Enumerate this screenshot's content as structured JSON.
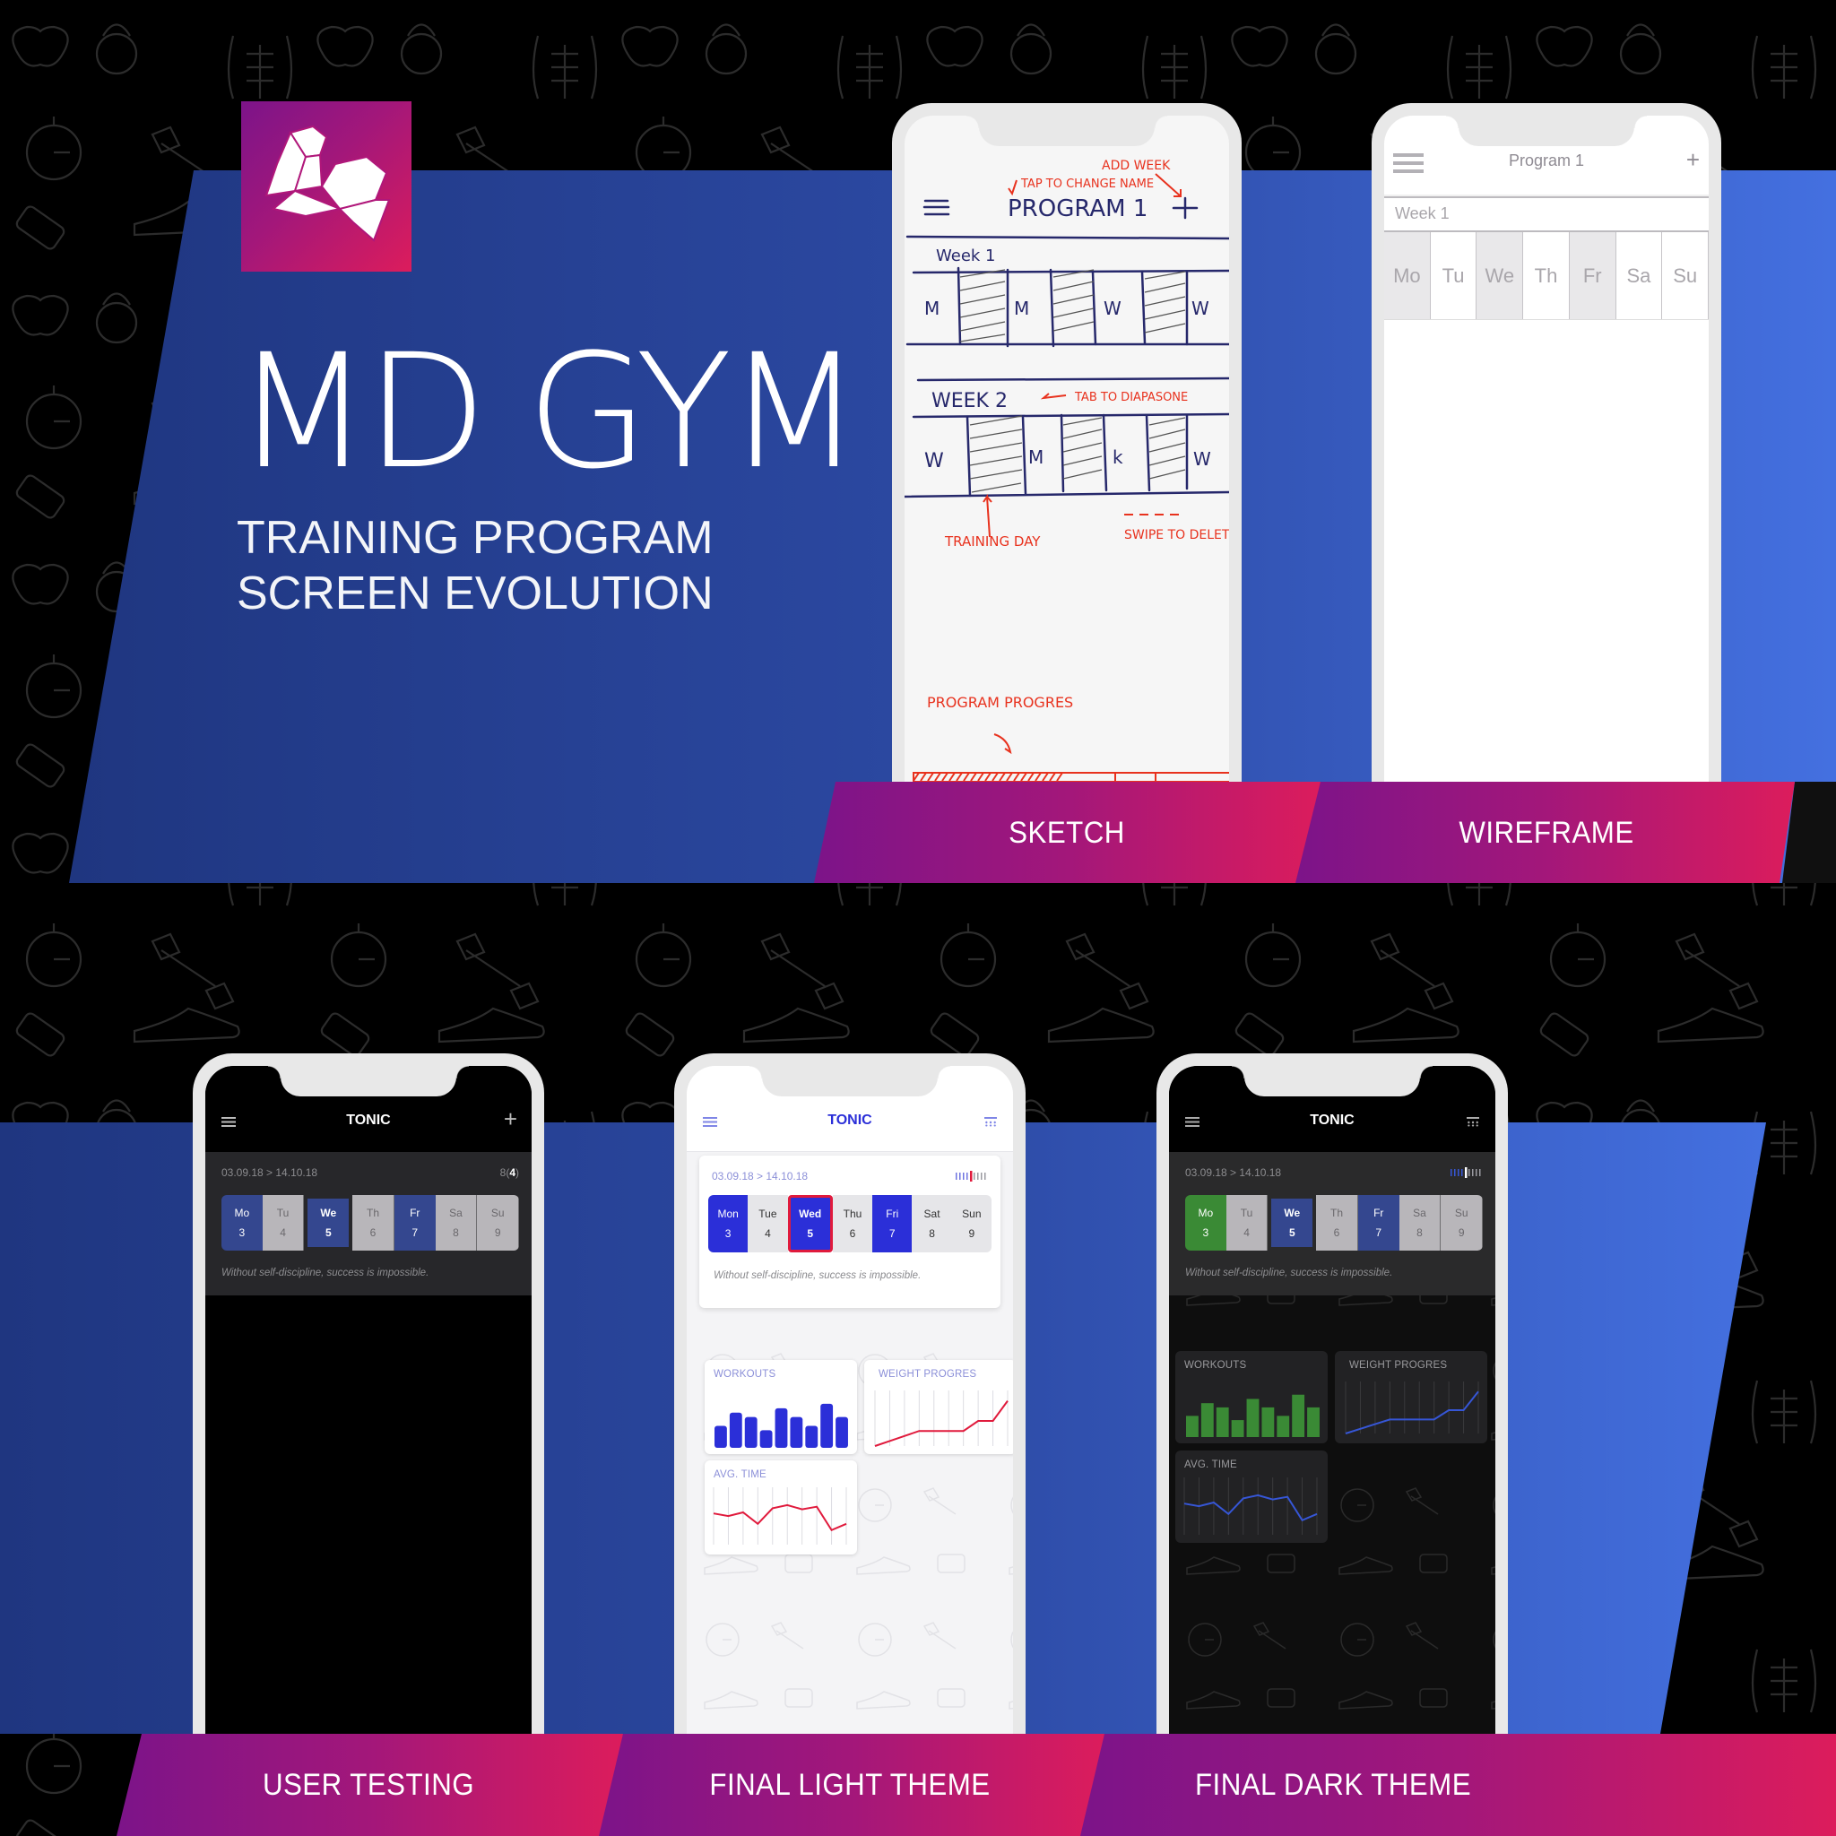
{
  "brand": {
    "title": "MD GYM",
    "subtitle_line1": "TRAINING PROGRAM",
    "subtitle_line2": "SCREEN EVOLUTION",
    "logo_icon": "flexed-bicep-icon",
    "colors": {
      "background": "#000000",
      "band_blue_dark": "#1f3680",
      "band_blue_light": "#4470e0",
      "label_purple": "#7c1489",
      "label_pink": "#dc1c5c"
    }
  },
  "stages": [
    {
      "id": "sketch",
      "label": "SKETCH"
    },
    {
      "id": "wireframe",
      "label": "WIREFRAME"
    },
    {
      "id": "user_testing",
      "label": "USER TESTING"
    },
    {
      "id": "final_light",
      "label": "FINAL LIGHT THEME"
    },
    {
      "id": "final_dark",
      "label": "FINAL DARK THEME"
    }
  ],
  "sketch": {
    "title": "PROGRAM 1",
    "week1": "Week 1",
    "week2": "WEEK 2",
    "day_letters": [
      "M",
      "M",
      "M",
      "M",
      "W",
      "W",
      "W"
    ],
    "annotations": {
      "add_week": "ADD WEEK",
      "tap_change_name": "TAP TO CHANGE NAME",
      "tab_diapasone": "TAB TO DIAPASONE",
      "training_day": "TRAINING DAY",
      "swipe_delete": "SWIPE TO DELETE",
      "program_progress": "PROGRAM PROGRES"
    },
    "annotation_color": "#e8321e",
    "ink_color": "#26286b"
  },
  "wireframe": {
    "title": "Program 1",
    "add_icon": "+",
    "week_label": "Week 1",
    "days": [
      {
        "label": "Mo",
        "filled": true
      },
      {
        "label": "Tu",
        "filled": false
      },
      {
        "label": "We",
        "filled": true
      },
      {
        "label": "Th",
        "filled": false
      },
      {
        "label": "Fr",
        "filled": true
      },
      {
        "label": "Sa",
        "filled": false
      },
      {
        "label": "Su",
        "filled": false
      }
    ]
  },
  "user_testing": {
    "app_title": "TONIC",
    "add_icon": "+",
    "date_range": "03.09.18 > 14.10.18",
    "counter_prefix": "8(",
    "counter_value": "4",
    "counter_suffix": ")",
    "quote": "Without self-discipline, success is impossible.",
    "days": [
      {
        "name": "Mo",
        "num": "3",
        "state": "training"
      },
      {
        "name": "Tu",
        "num": "4",
        "state": "rest"
      },
      {
        "name": "We",
        "num": "5",
        "state": "today"
      },
      {
        "name": "Th",
        "num": "6",
        "state": "rest"
      },
      {
        "name": "Fr",
        "num": "7",
        "state": "training"
      },
      {
        "name": "Sa",
        "num": "8",
        "state": "rest"
      },
      {
        "name": "Su",
        "num": "9",
        "state": "rest"
      }
    ]
  },
  "final_light": {
    "app_title": "TONIC",
    "date_range": "03.09.18 > 14.10.18",
    "quote": "Without self-discipline, success is impossible.",
    "accent": "#2b2fd8",
    "chart_line_color": "#e01a3c",
    "days": [
      {
        "name": "Mon",
        "num": "3",
        "state": "training"
      },
      {
        "name": "Tue",
        "num": "4",
        "state": "rest"
      },
      {
        "name": "Wed",
        "num": "5",
        "state": "today"
      },
      {
        "name": "Thu",
        "num": "6",
        "state": "rest"
      },
      {
        "name": "Fri",
        "num": "7",
        "state": "training"
      },
      {
        "name": "Sat",
        "num": "8",
        "state": "rest"
      },
      {
        "name": "Sun",
        "num": "9",
        "state": "rest"
      }
    ],
    "cards": {
      "workouts": "WORKOUTS",
      "weight": "WEIGHT PROGRES",
      "avg_time": "AVG. TIME"
    }
  },
  "final_dark": {
    "app_title": "TONIC",
    "date_range": "03.09.18 > 14.10.18",
    "quote": "Without self-discipline, success is impossible.",
    "done_color": "#3a8a35",
    "accent": "#34478f",
    "chart_line_color": "#3656d6",
    "days": [
      {
        "name": "Mo",
        "num": "3",
        "state": "done"
      },
      {
        "name": "Tu",
        "num": "4",
        "state": "rest"
      },
      {
        "name": "We",
        "num": "5",
        "state": "today"
      },
      {
        "name": "Th",
        "num": "6",
        "state": "rest"
      },
      {
        "name": "Fr",
        "num": "7",
        "state": "training"
      },
      {
        "name": "Sa",
        "num": "8",
        "state": "rest"
      },
      {
        "name": "Su",
        "num": "9",
        "state": "rest"
      }
    ],
    "cards": {
      "workouts": "WORKOUTS",
      "weight": "WEIGHT PROGRES",
      "avg_time": "AVG. TIME"
    }
  },
  "chart_data": [
    {
      "type": "bar",
      "title": "WORKOUTS",
      "categories": [
        "1",
        "2",
        "3",
        "4",
        "5",
        "6",
        "7",
        "8",
        "9"
      ],
      "values": [
        5,
        8,
        7,
        4,
        9,
        7,
        5,
        10,
        7
      ],
      "ylim": [
        0,
        11
      ]
    },
    {
      "type": "line",
      "title": "WEIGHT PROGRES",
      "x": [
        1,
        2,
        3,
        4,
        5,
        6,
        7,
        8,
        9,
        10
      ],
      "values": [
        0,
        1,
        2,
        3,
        3,
        3,
        3,
        5,
        5,
        9
      ],
      "ylim": [
        0,
        10
      ]
    },
    {
      "type": "line",
      "title": "AVG. TIME",
      "x": [
        1,
        2,
        3,
        4,
        5,
        6,
        7,
        8,
        9,
        10
      ],
      "values": [
        6,
        5.5,
        6.2,
        4,
        7,
        7.6,
        6.8,
        7.3,
        2.8,
        4
      ],
      "ylim": [
        0,
        10
      ]
    }
  ]
}
